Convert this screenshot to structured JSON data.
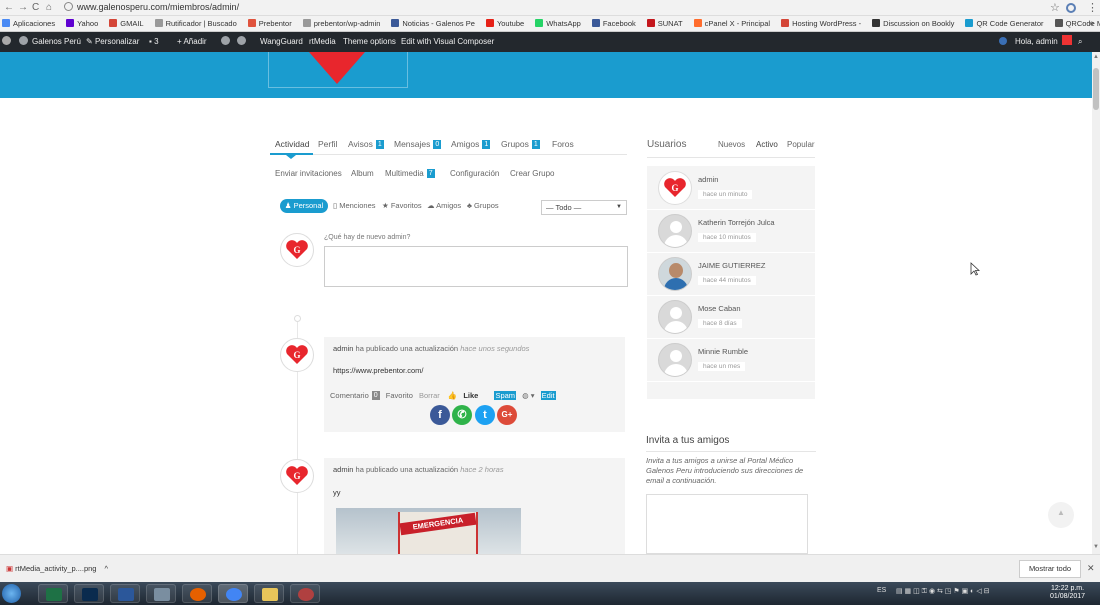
{
  "browser": {
    "back": "←",
    "forward": "→",
    "reload": "C",
    "home": "⌂",
    "url": "www.galenosperu.com/miembros/admin/",
    "star": "☆",
    "menu": "⋮"
  },
  "bookmarks": [
    {
      "label": "Aplicaciones",
      "color": "#4a8af4"
    },
    {
      "label": "Yahoo",
      "color": "#5f01d1"
    },
    {
      "label": "GMAIL",
      "color": "#d44638"
    },
    {
      "label": "Rutificador | Buscado",
      "color": "#999999"
    },
    {
      "label": "Prebentor",
      "color": "#e0533d"
    },
    {
      "label": "prebentor/wp-admin",
      "color": "#999999"
    },
    {
      "label": "Noticias - Galenos Pe",
      "color": "#3b5998"
    },
    {
      "label": "Youtube",
      "color": "#e62117"
    },
    {
      "label": "WhatsApp",
      "color": "#25d366"
    },
    {
      "label": "Facebook",
      "color": "#3b5998"
    },
    {
      "label": "SUNAT",
      "color": "#c4161c"
    },
    {
      "label": "cPanel X - Principal",
      "color": "#ff6c2c"
    },
    {
      "label": "Hosting WordPress -",
      "color": "#d44638"
    },
    {
      "label": "Discussion on Bookly",
      "color": "#333333"
    },
    {
      "label": "QR Code Generator",
      "color": "#1a9ccf"
    },
    {
      "label": "QRCode Monkey - El",
      "color": "#555555"
    }
  ],
  "bookmarks_more": "»",
  "wpbar": {
    "site": "Galenos Perú",
    "customize": "Personalizar",
    "comments": "3",
    "new": "Añadir",
    "wangguard": "WangGuard",
    "rtmedia": "rtMedia",
    "theme_options": "Theme options",
    "vc": "Edit with Visual Composer",
    "greeting": "Hola, admin"
  },
  "tabs": [
    {
      "label": "Actividad",
      "count": null
    },
    {
      "label": "Perfil",
      "count": null
    },
    {
      "label": "Avisos",
      "count": "1"
    },
    {
      "label": "Mensajes",
      "count": "0"
    },
    {
      "label": "Amigos",
      "count": "1"
    },
    {
      "label": "Grupos",
      "count": "1"
    },
    {
      "label": "Foros",
      "count": null
    }
  ],
  "subtabs": {
    "invites": "Enviar invitaciones",
    "album": "Album",
    "media": "Multimedia",
    "media_count": "7",
    "config": "Configuración",
    "create_group": "Crear Grupo"
  },
  "filters": {
    "personal": "Personal",
    "mentions": "Menciones",
    "favorites": "Favoritos",
    "friends": "Amigos",
    "groups": "Grupos",
    "select": "— Todo —"
  },
  "post_form": {
    "placeholder": "¿Qué hay de nuevo admin?"
  },
  "activity": [
    {
      "user": "admin",
      "action": "ha publicado una actualización",
      "time": "hace unos segundos",
      "content": "https://www.prebentor.com/",
      "comment": "Comentario",
      "comment_count": "0",
      "favorite": "Favorito",
      "delete": "Borrar",
      "like": "Like",
      "spam": "Spam",
      "edit": "Edit"
    },
    {
      "user": "admin",
      "action": "ha publicado una actualización",
      "time": "hace 2 horas",
      "content": "yy",
      "image_text": "EMERGENCIA"
    }
  ],
  "share_icons": [
    {
      "icon": "facebook-icon",
      "glyph": "f",
      "color": "#3b5998"
    },
    {
      "icon": "whatsapp-icon",
      "glyph": "✆",
      "color": "#2fb34a"
    },
    {
      "icon": "twitter-icon",
      "glyph": "t",
      "color": "#1da1f2"
    },
    {
      "icon": "googleplus-icon",
      "glyph": "G+",
      "color": "#dd4b39"
    }
  ],
  "sidebar": {
    "title": "Usuarios",
    "tabs": [
      "Nuevos",
      "Activo",
      "Popular"
    ],
    "users": [
      {
        "name": "admin",
        "time": "hace un minuto",
        "avatar": "logo"
      },
      {
        "name": "Katherin Torrejón Julca",
        "time": "hace 10 minutos",
        "avatar": "default"
      },
      {
        "name": "JAIME GUTIERREZ",
        "time": "hace 44 minutos",
        "avatar": "photo"
      },
      {
        "name": "Mose Caban",
        "time": "hace 8 días",
        "avatar": "default"
      },
      {
        "name": "Minnie Rumble",
        "time": "hace un mes",
        "avatar": "default"
      }
    ],
    "invite_title": "Invita a tus amigos",
    "invite_text": "Invita a tus amigos a unirse al Portal Médico Galenos Peru introduciendo sus direcciones de email a continuación."
  },
  "download": {
    "file": "rtMedia_activity_p....png",
    "show_all": "Mostrar todo",
    "close": "✕"
  },
  "taskbar": {
    "lang": "ES",
    "time": "12:22 p.m.",
    "date": "01/08/2017"
  }
}
